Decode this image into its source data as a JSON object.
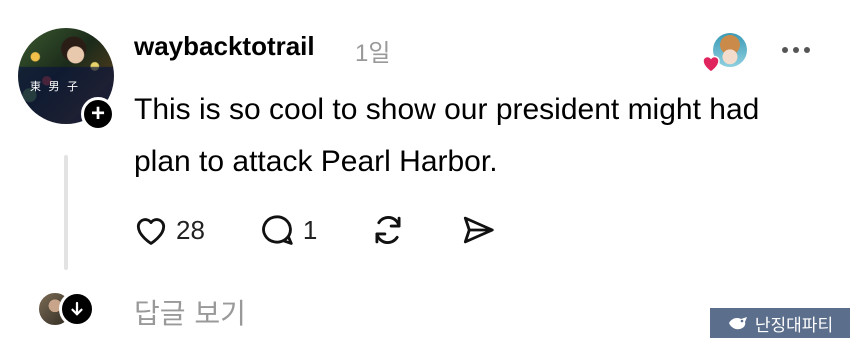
{
  "post": {
    "username": "waybacktotrail",
    "timestamp": "1일",
    "text": "This is so cool to show our president might had plan to attack Pearl Harbor.",
    "avatar_caption": "東 男 子",
    "likes": "28",
    "replies": "1"
  },
  "replies": {
    "view_label": "답글 보기"
  },
  "watermark": {
    "text": "난징대파티"
  },
  "icons": {
    "follow": "plus-icon",
    "more": "more-horizontal-icon",
    "like": "heart-icon",
    "reply": "comment-icon",
    "repost": "repost-icon",
    "share": "send-icon",
    "expand_replies": "arrow-down-icon"
  },
  "colors": {
    "heart_badge": "#e0245e",
    "muted_text": "#999999",
    "watermark_bg": "#5b6f8c"
  }
}
